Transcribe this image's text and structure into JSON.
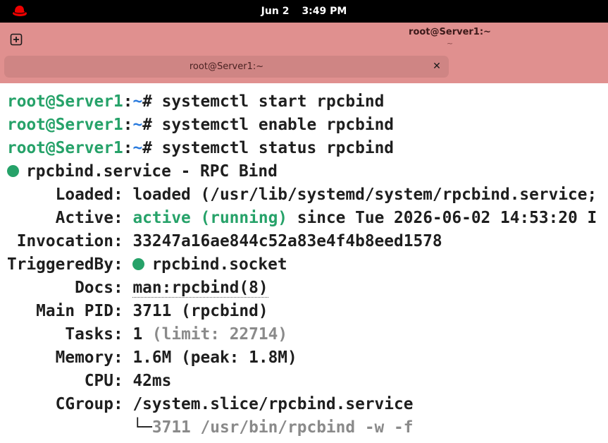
{
  "topbar": {
    "date": "Jun 2",
    "time": "3:49 PM",
    "logo_icon": "redhat-logo-icon"
  },
  "window": {
    "title": "root@Server1:~",
    "subtitle": "~",
    "new_tab_icon": "new-tab-icon"
  },
  "tabs": [
    {
      "label": "root@Server1:~",
      "close_icon": "close-icon"
    }
  ],
  "terminal": {
    "prompt_user": "root@Server1",
    "prompt_sep": ":",
    "prompt_path": "~",
    "prompt_symbol": "# ",
    "commands": [
      "systemctl start rpcbind",
      "systemctl enable rpcbind",
      "systemctl status rpcbind"
    ],
    "status": {
      "unit_line": "rpcbind.service - RPC Bind",
      "loaded_label": "     Loaded: ",
      "loaded_value": "loaded (/usr/lib/systemd/system/rpcbind.service;",
      "active_label": "     Active: ",
      "active_state": "active (running)",
      "active_since": " since Tue 2026-06-02 14:53:20 I",
      "invocation_label": " Invocation: ",
      "invocation_value": "33247a16ae844c52a83e4f4b8eed1578",
      "triggered_label": "TriggeredBy: ",
      "triggered_value": "rpcbind.socket",
      "docs_label": "       Docs: ",
      "docs_value": "man:rpcbind(8)",
      "mainpid_label": "   Main PID: ",
      "mainpid_value": "3711 (rpcbind)",
      "tasks_label": "      Tasks: ",
      "tasks_value": "1",
      "tasks_limit": " (limit: 22714)",
      "memory_label": "     Memory: ",
      "memory_value": "1.6M (peak: 1.8M)",
      "cpu_label": "        CPU: ",
      "cpu_value": "42ms",
      "cgroup_label": "     CGroup: ",
      "cgroup_value": "/system.slice/rpcbind.service",
      "process_tree": "             └─",
      "process_value": "3711 /usr/bin/rpcbind -w -f"
    }
  },
  "colors": {
    "header_bg": "#e0908f",
    "tab_bg": "#cf8584",
    "prompt_user": "#26a269",
    "prompt_path": "#2a7bde",
    "active_green": "#26a269"
  }
}
